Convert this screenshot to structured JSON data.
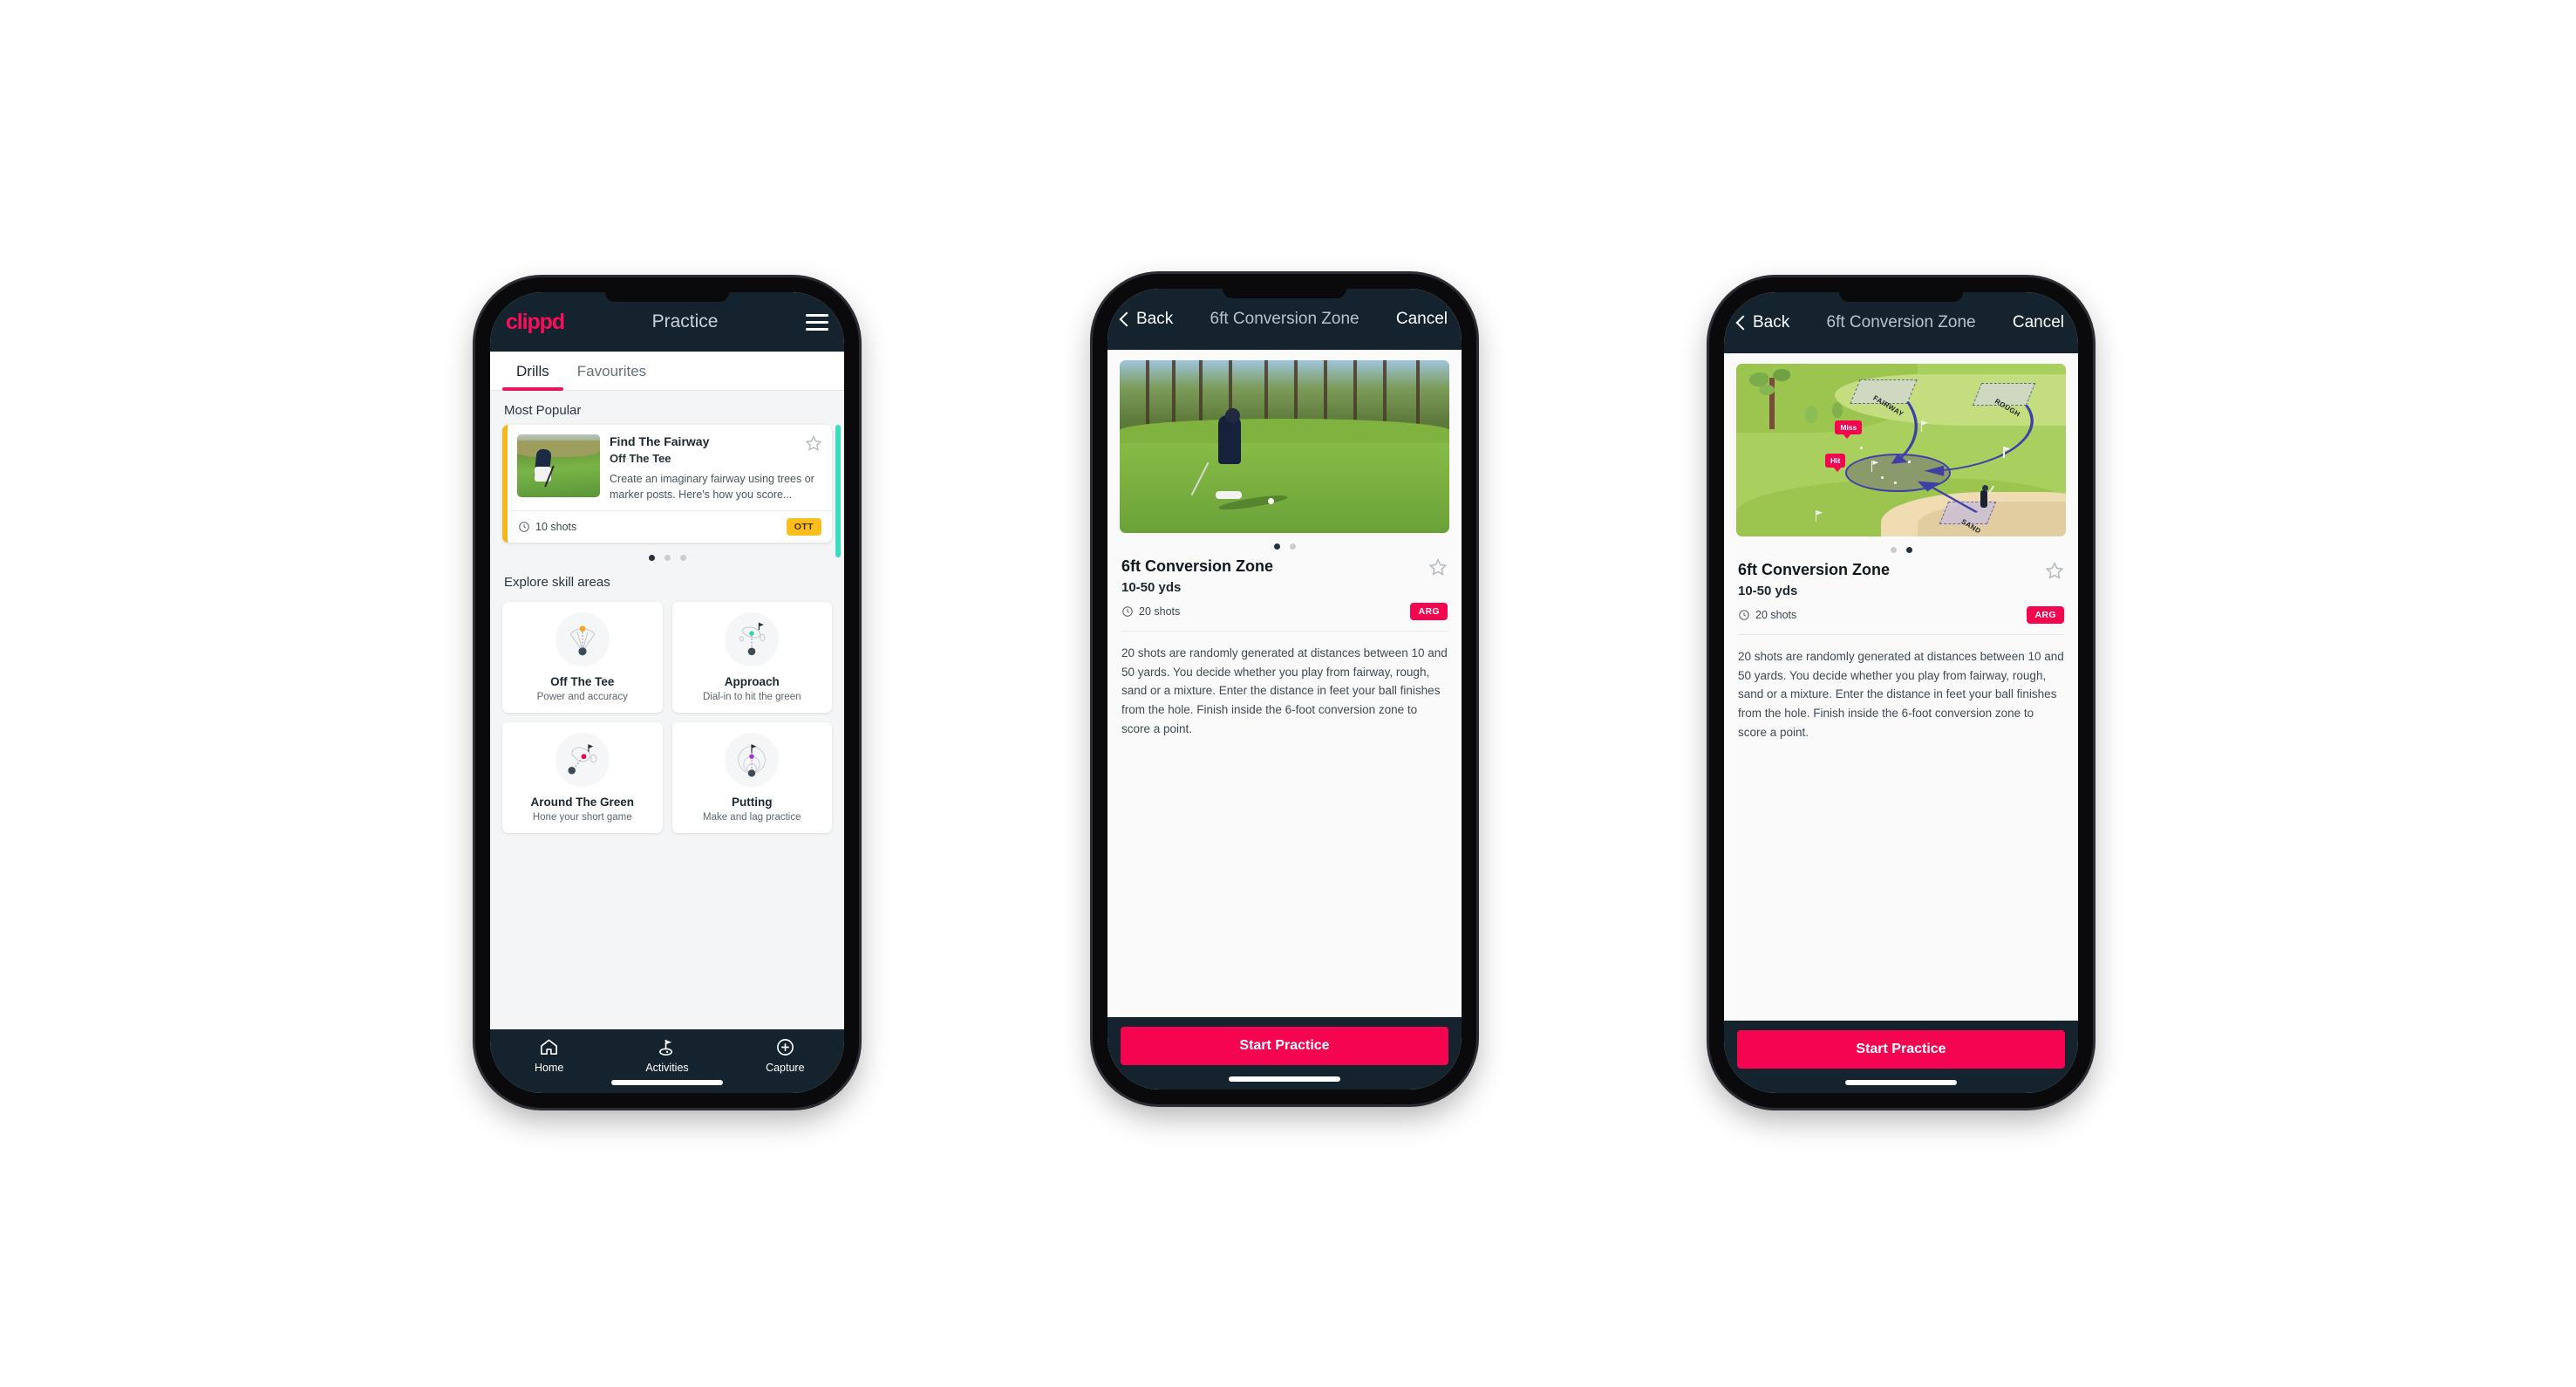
{
  "phone1": {
    "appbar": {
      "logo": "clippd",
      "title": "Practice",
      "menu_icon": "hamburger-icon"
    },
    "tabs": [
      {
        "label": "Drills",
        "active": true
      },
      {
        "label": "Favourites",
        "active": false
      }
    ],
    "section_title": "Most Popular",
    "drill_card": {
      "title": "Find The Fairway",
      "subtitle": "Off The Tee",
      "description": "Create an imaginary fairway using trees or marker posts. Here's how you score...",
      "shots": "10 shots",
      "chip": "OTT",
      "chip_color": "#fdbd1c",
      "accent_color": "#f5b721",
      "star_icon": "star-outline-icon",
      "clock_icon": "clock-icon"
    },
    "carousel_dots": {
      "count": 3,
      "active": 0
    },
    "explore_title": "Explore skill areas",
    "skills": [
      {
        "name": "Off The Tee",
        "desc": "Power and accuracy",
        "icon": "tee-fan-icon",
        "dot_color": "#f5a623"
      },
      {
        "name": "Approach",
        "desc": "Dial-in to hit the green",
        "icon": "approach-green-icon",
        "dot_color": "#2fd6ad"
      },
      {
        "name": "Around The Green",
        "desc": "Hone your short game",
        "icon": "chip-green-icon",
        "dot_color": "#f5054f"
      },
      {
        "name": "Putting",
        "desc": "Make and lag practice",
        "icon": "putting-rings-icon",
        "dot_color": "#b02de0"
      }
    ],
    "bottom_nav": [
      {
        "label": "Home",
        "icon": "home-icon",
        "active": false
      },
      {
        "label": "Activities",
        "icon": "golf-flag-icon",
        "active": true
      },
      {
        "label": "Capture",
        "icon": "plus-circle-icon",
        "active": false
      }
    ]
  },
  "phone2": {
    "appbar": {
      "back": "Back",
      "title": "6ft Conversion Zone",
      "cancel": "Cancel",
      "back_icon": "chevron-left-icon"
    },
    "media_type": "photo",
    "carousel_dots": {
      "count": 2,
      "active": 0
    },
    "detail": {
      "title": "6ft Conversion Zone",
      "yards": "10-50 yds",
      "shots": "20 shots",
      "chip": "ARG",
      "chip_color": "#f5054f",
      "star_icon": "star-outline-icon",
      "clock_icon": "clock-icon",
      "description": "20 shots are randomly generated at distances between 10 and 50 yards. You decide whether you play from fairway, rough, sand or a mixture. Enter the distance in feet your ball finishes from the hole. Finish inside the 6-foot conversion zone to score a point."
    },
    "cta": "Start Practice"
  },
  "phone3": {
    "appbar": {
      "back": "Back",
      "title": "6ft Conversion Zone",
      "cancel": "Cancel",
      "back_icon": "chevron-left-icon"
    },
    "media_type": "illustration",
    "illustration": {
      "labels": [
        "FAIRWAY",
        "ROUGH",
        "SAND"
      ],
      "bubbles": [
        "Miss",
        "Hit"
      ]
    },
    "carousel_dots": {
      "count": 2,
      "active": 1
    },
    "detail": {
      "title": "6ft Conversion Zone",
      "yards": "10-50 yds",
      "shots": "20 shots",
      "chip": "ARG",
      "chip_color": "#f5054f",
      "star_icon": "star-outline-icon",
      "clock_icon": "clock-icon",
      "description": "20 shots are randomly generated at distances between 10 and 50 yards. You decide whether you play from fairway, rough, sand or a mixture. Enter the distance in feet your ball finishes from the hole. Finish inside the 6-foot conversion zone to score a point."
    },
    "cta": "Start Practice"
  }
}
